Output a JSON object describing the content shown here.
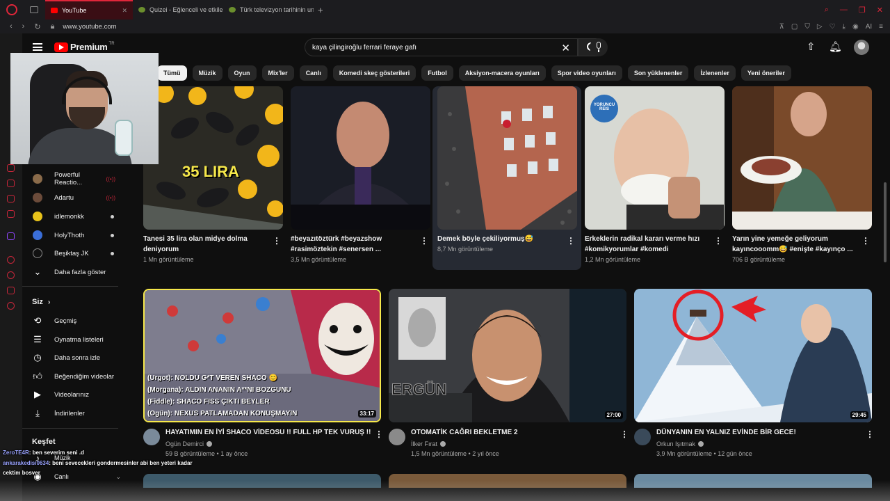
{
  "browser": {
    "tabs": [
      {
        "label": "YouTube",
        "active": true
      },
      {
        "label": "Quizei - Eğlenceli ve etkileşimli",
        "active": false
      },
      {
        "label": "Türk televizyon tarihinin unutulmaz",
        "active": false
      }
    ],
    "url": "www.youtube.com",
    "ai_label": "AI"
  },
  "header": {
    "brand": "Premium",
    "region": "TR",
    "search_query": "kaya çilingiroğlu ferrari feraye gafı"
  },
  "chips": [
    "Tümü",
    "Müzik",
    "Oyun",
    "Mix'ler",
    "Canlı",
    "Komedi skeç gösterileri",
    "Futbol",
    "Aksiyon-macera oyunları",
    "Spor video oyunları",
    "Son yüklenenler",
    "İzlenenler",
    "Yeni öneriler"
  ],
  "sidebar": {
    "subscriptions": [
      {
        "name": "Powerful Reactio...",
        "status": "live"
      },
      {
        "name": "Adartu",
        "status": "live"
      },
      {
        "name": "idlemonkk",
        "status": "new"
      },
      {
        "name": "HolyThoth",
        "status": "new"
      },
      {
        "name": "Beşiktaş JK",
        "status": "new"
      }
    ],
    "show_more": "Daha fazla göster",
    "you_section": "Siz",
    "you_items": [
      "Geçmiş",
      "Oynatma listeleri",
      "Daha sonra izle",
      "Beğendiğim videolar",
      "Videolarınız",
      "İndirilenler"
    ],
    "explore_section": "Keşfet",
    "explore_items": [
      "Müzik",
      "Canlı"
    ]
  },
  "shorts": [
    {
      "title": "Tanesi 35 lira olan midye dolma deniyorum",
      "views": "1 Mn görüntüleme",
      "overlay_text": "35 LIRA"
    },
    {
      "title": "#beyazıtöztürk #beyazshow #rasimöztekin #senersen ...",
      "views": "3,5 Mn görüntüleme"
    },
    {
      "title": "Demek böyle çekiliyormuş😅",
      "views": "8,7 Mn görüntüleme"
    },
    {
      "title": "Erkeklerin radikal kararı verme hızı #komikyorumlar #komedi",
      "views": "1,2 Mn görüntüleme",
      "badge": "YORUNCU REIS"
    },
    {
      "title": "Yarın yine yemeğe geliyorum kayıncooomm😅 #enişte #kayınço ...",
      "views": "706 B görüntüleme"
    }
  ],
  "videos": [
    {
      "title": "HAYATIMIN EN İYİ SHACO VİDEOSU !! FULL HP TEK VURUŞ !!",
      "channel": "Ogün Demirci",
      "views": "59 B görüntüleme",
      "age": "1 ay önce",
      "duration": "33:17",
      "thumb_lines": [
        "(Urgot): NOLDU G*T VEREN SHACO 😊",
        "(Morgana): ALDIN ANANIN A**NI BOZGUNU",
        "(Fiddle): SHACO FISS ÇIKTI BEYLER",
        "(Ogün): NEXUS PATLAMADAN KONUŞMAYIN"
      ]
    },
    {
      "title": "OTOMATİK CAĞRI BEKLETME 2",
      "channel": "İlker Fırat",
      "views": "1,5 Mn görüntüleme",
      "age": "2 yıl önce",
      "duration": "27:00",
      "thumb_text": "ERGÜN"
    },
    {
      "title": "DÜNYANIN EN YALNIZ EVİNDE BİR GECE!",
      "channel": "Orkun Işıtmak",
      "views": "3,9 Mn görüntüleme",
      "age": "12 gün önce",
      "duration": "29:45"
    }
  ],
  "chat": [
    {
      "user": "ZeroTE4R",
      "message": ": ben severim seni .d"
    },
    {
      "user": "ankarakedisi0634",
      "message": ": beni sevecekleri gondermesinler abi ben yeteri kadar"
    },
    {
      "user": "",
      "message": "cektim bosver"
    }
  ],
  "colors": {
    "accent": "#ff0000",
    "opera": "#e0263a",
    "background": "#0f0f0f",
    "chip_bg": "#272727",
    "hover_card": "#262a33"
  }
}
